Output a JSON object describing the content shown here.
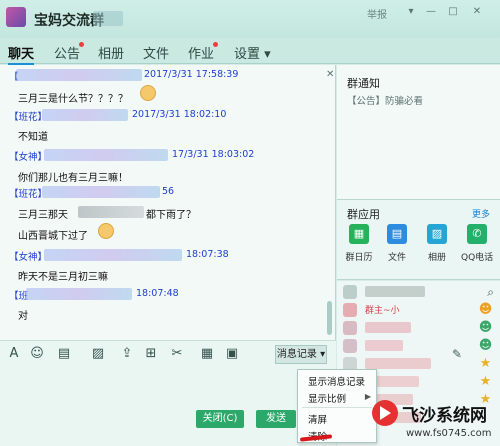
{
  "window": {
    "group_name": "宝妈交流群",
    "report_label": "举报",
    "controls": [
      "▾",
      "—",
      "□",
      "✕"
    ]
  },
  "tabs": [
    {
      "label": "聊天",
      "active": true
    },
    {
      "label": "公告",
      "badge": true
    },
    {
      "label": "相册"
    },
    {
      "label": "文件"
    },
    {
      "label": "作业",
      "badge": true
    },
    {
      "label": "设置 ▾"
    }
  ],
  "messages": [
    {
      "header": "【",
      "time": "2017/3/31 17:58:39",
      "body": "三月三是什么节？？？？"
    },
    {
      "header": "【班花】",
      "time": "2017/3/31 18:02:10",
      "body": "不知道"
    },
    {
      "header": "【女神】",
      "time": "17/3/31 18:03:02",
      "body": "你们那儿也有三月三嘛！"
    },
    {
      "header": "【班花】",
      "time": "56",
      "body_a": "三月三那天",
      "body_b": "都下雨了？",
      "body_c": "山西晋城下过了"
    },
    {
      "header": "【女神】",
      "time": "18:07:38",
      "body": "昨天不是三月初三嘛"
    },
    {
      "header": "【班",
      "time": "18:07:48",
      "body": "对"
    }
  ],
  "notice": {
    "title": "群通知",
    "text": "【公告】防骗必看"
  },
  "apps": {
    "title": "群应用",
    "more": "更多",
    "items": [
      {
        "label": "群日历",
        "icon": "calendar-icon",
        "color": "#26b25a",
        "glyph": "▦"
      },
      {
        "label": "文件",
        "icon": "folder-icon",
        "color": "#2c8de0",
        "glyph": "▤"
      },
      {
        "label": "相册",
        "icon": "photo-icon",
        "color": "#25a5d6",
        "glyph": "▨"
      },
      {
        "label": "QQ电话",
        "icon": "phone-icon",
        "color": "#22b06a",
        "glyph": "✆"
      }
    ]
  },
  "members": {
    "owner_label": "群主~小",
    "search_glyph": "⌕"
  },
  "toolbar": {
    "history_label": "消息记录 ▾",
    "tools": [
      "A",
      "☺",
      "▤",
      "▨",
      "⇪",
      "⊞",
      "✂",
      "▦",
      "▣"
    ]
  },
  "buttons": {
    "close": "关闭(C)",
    "send": "发送"
  },
  "history_menu": {
    "items": [
      "显示消息记录",
      "显示比例",
      "清屏",
      "清除"
    ]
  },
  "watermark": {
    "title": "飞沙系统网",
    "url": "www.fs0745.com"
  },
  "colors": {
    "accent": "#1a8fd6",
    "header_blue": "#1f3fcf",
    "button_green": "#2ca96a"
  }
}
